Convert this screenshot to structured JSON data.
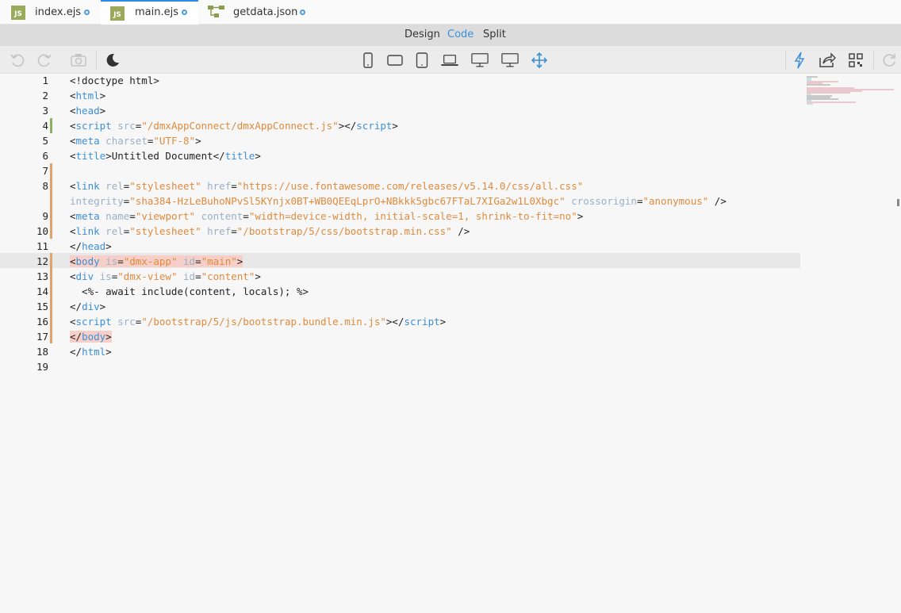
{
  "tabs": [
    {
      "name": "index.ejs",
      "icon": "js-file-icon",
      "active": false
    },
    {
      "name": "main.ejs",
      "icon": "js-file-icon",
      "active": true
    },
    {
      "name": "getdata.json",
      "icon": "json-tree-icon",
      "active": false
    }
  ],
  "modes": {
    "design": "Design",
    "code": "Code",
    "split": "Split",
    "selected": "Code"
  },
  "toolbar": {
    "left": [
      "undo-icon",
      "redo-icon",
      "screenshot-icon",
      "dark-mode-icon"
    ],
    "center": [
      "phone-portrait-icon",
      "phone-landscape-icon",
      "tablet-icon",
      "laptop-icon",
      "desktop-icon",
      "wide-desktop-icon",
      "move-icon"
    ],
    "right": [
      "lightning-icon",
      "share-icon",
      "qr-code-icon",
      "refresh-icon"
    ]
  },
  "code": {
    "line_numbers": [
      "1",
      "2",
      "3",
      "4",
      "5",
      "6",
      "7",
      "8",
      "",
      "9",
      "10",
      "11",
      "12",
      "13",
      "14",
      "15",
      "16",
      "17",
      "18",
      "19"
    ],
    "l1": "<!doctype html>",
    "l2a": "<",
    "l2b": "html",
    "l2c": ">",
    "l3a": "<",
    "l3b": "head",
    "l3c": ">",
    "l4a": "<",
    "l4b": "script",
    "l4c": " src",
    "l4d": "=",
    "l4e": "\"/dmxAppConnect/dmxAppConnect.js\"",
    "l4f": "></",
    "l4g": "script",
    "l4h": ">",
    "l5a": "<",
    "l5b": "meta",
    "l5c": " charset",
    "l5d": "=",
    "l5e": "\"UTF-8\"",
    "l5f": ">",
    "l6a": "<",
    "l6b": "title",
    "l6c": ">Untitled Document</",
    "l6d": "title",
    "l6e": ">",
    "l8a": "<",
    "l8b": "link",
    "l8c": " rel",
    "l8d": "=",
    "l8e": "\"stylesheet\"",
    "l8f": " href",
    "l8g": "=",
    "l8h": "\"https://use.fontawesome.com/releases/v5.14.0/css/all.css\"",
    "l8w1": "integrity",
    "l8w2": "=",
    "l8w3": "\"sha384-HzLeBuhoNPvSl5KYnjx0BT+WB0QEEqLprO+NBkkk5gbc67FTaL7XIGa2w1L0Xbgc\"",
    "l8w4": " crossorigin",
    "l8w5": "=",
    "l8w6": "\"anonymous\"",
    "l8w7": " />",
    "l9a": "<",
    "l9b": "meta",
    "l9c": " name",
    "l9d": "=",
    "l9e": "\"viewport\"",
    "l9f": " content",
    "l9g": "=",
    "l9h": "\"width=device-width, initial-scale=1, shrink-to-fit=no\"",
    "l9i": ">",
    "l10a": "<",
    "l10b": "link",
    "l10c": " rel",
    "l10d": "=",
    "l10e": "\"stylesheet\"",
    "l10f": " href",
    "l10g": "=",
    "l10h": "\"/bootstrap/5/css/bootstrap.min.css\"",
    "l10i": " />",
    "l11a": "</",
    "l11b": "head",
    "l11c": ">",
    "l12a": "<",
    "l12b": "body",
    "l12c": " is",
    "l12d": "=",
    "l12e": "\"dmx-app\"",
    "l12f": " id",
    "l12g": "=",
    "l12h": "\"main\"",
    "l12i": ">",
    "l13a": "<",
    "l13b": "div",
    "l13c": " is",
    "l13d": "=",
    "l13e": "\"dmx-view\"",
    "l13f": " id",
    "l13g": "=",
    "l13h": "\"content\"",
    "l13i": ">",
    "l14": "  <%- await include(content, locals); %>",
    "l15a": "</",
    "l15b": "div",
    "l15c": ">",
    "l16a": "<",
    "l16b": "script",
    "l16c": " src",
    "l16d": "=",
    "l16e": "\"/bootstrap/5/js/bootstrap.bundle.min.js\"",
    "l16f": "></",
    "l16g": "script",
    "l16h": ">",
    "l17a": "</",
    "l17b": "body",
    "l17c": ">",
    "l18a": "</",
    "l18b": "html",
    "l18c": ">"
  },
  "colors": {
    "tag": "#3b8fd9",
    "attr": "#9ab0c8",
    "string": "#e08a3c",
    "accent": "#2f8ae5",
    "change": "#e0a36a",
    "change_added": "#8bb35f"
  }
}
